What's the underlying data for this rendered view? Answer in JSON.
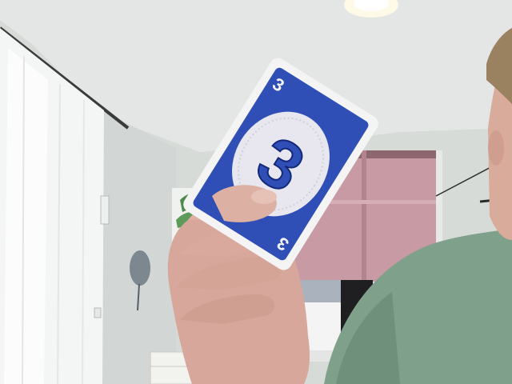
{
  "scene": {
    "description_tags": [
      "room",
      "hand",
      "playing-card"
    ]
  },
  "card": {
    "number": "3",
    "corner_top_left": "3",
    "corner_bottom_right": "3",
    "card_color": "#2f4fb6",
    "border_color": "#f4f4f4",
    "center_circle_color": "#e8e6ee"
  },
  "colors": {
    "wall": "#d7dbd8",
    "ceiling": "#e3e6e4",
    "curtain": "#f4f6f6",
    "window_blind": "#c79aa4",
    "shirt": "#7fa08a",
    "skin": "#d6a79a"
  }
}
